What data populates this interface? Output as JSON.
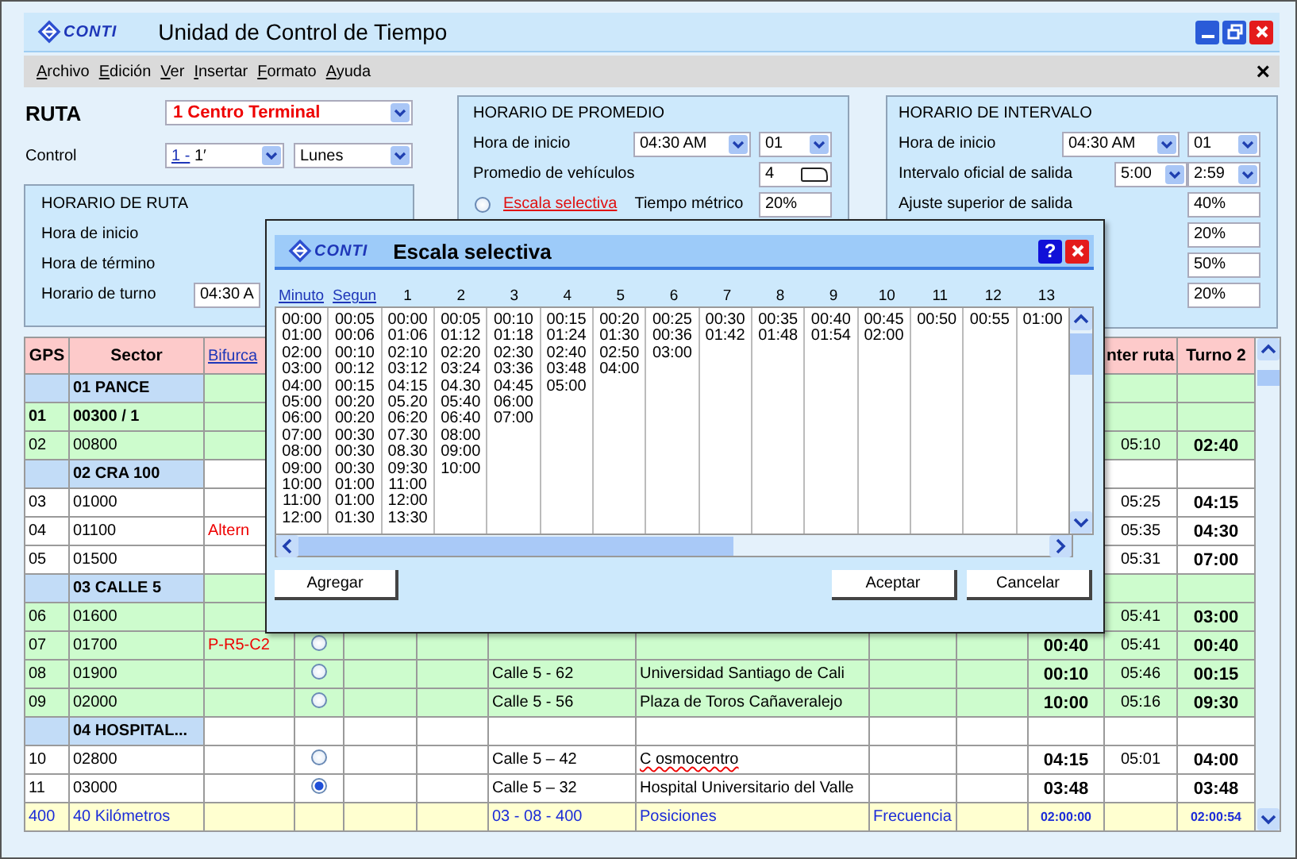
{
  "window": {
    "logo": "CONTI",
    "title": "Unidad de Control de Tiempo"
  },
  "menu": {
    "items": [
      "Archivo",
      "Edición",
      "Ver",
      "Insertar",
      "Formato",
      "Ayuda"
    ],
    "close": "×"
  },
  "route": {
    "label": "RUTA",
    "value": "1 Centro Terminal"
  },
  "control": {
    "label": "Control",
    "code": "1 -",
    "minute": "1′",
    "day": "Lunes"
  },
  "route_schedule": {
    "title": "HORARIO DE RUTA",
    "rows": [
      {
        "label": "Hora de inicio"
      },
      {
        "label": "Hora de término"
      },
      {
        "label": "Horario de turno",
        "value": "04:30 A"
      }
    ]
  },
  "average_schedule": {
    "title": "HORARIO DE PROMEDIO",
    "start_label": "Hora de inicio",
    "start_time": "04:30 AM",
    "start_index": "01",
    "vehicles_label": "Promedio de vehículos",
    "vehicles": "4",
    "option": {
      "label": "Escala selectiva",
      "selected": false
    },
    "metric_label": "Tiempo métrico",
    "metric": "20%"
  },
  "interval_schedule": {
    "title": "HORARIO DE INTERVALO",
    "start_label": "Hora de inicio",
    "start_time": "04:30 AM",
    "start_index": "01",
    "interval_label": "Intervalo oficial de salida",
    "interval": "5:00",
    "interval_2": "2:59",
    "adjust_label": "Ajuste superior de salida",
    "adjust": "40%",
    "more_values": [
      "20%",
      "50%",
      "20%"
    ]
  },
  "table": {
    "header": {
      "gps": "GPS",
      "sector": "Sector",
      "branch": "Bifurca",
      "column_12": "nter ruta",
      "turn_2": "Turno 2"
    },
    "rows": [
      {
        "kind": "group",
        "highlighted": true,
        "sector": "01 PANCE"
      },
      {
        "kind": "main",
        "highlighted": true,
        "gps": "01",
        "sector": "00300 / 1"
      },
      {
        "kind": "stop",
        "highlighted": true,
        "gps": "02",
        "sector": "00800",
        "column_12": "05:10",
        "turn_2": "02:40"
      },
      {
        "kind": "group",
        "highlighted": false,
        "sector": "02 CRA 100"
      },
      {
        "kind": "stop",
        "highlighted": false,
        "gps": "03",
        "sector": "01000",
        "column_12": "05:25",
        "turn_2": "04:15"
      },
      {
        "kind": "stop",
        "highlighted": false,
        "gps": "04",
        "sector": "01100",
        "branch": "Altern",
        "column_12": "05:35",
        "turn_2": "04:30"
      },
      {
        "kind": "stop",
        "highlighted": false,
        "gps": "05",
        "sector": "01500",
        "column_12": "05:31",
        "turn_2": "07:00"
      },
      {
        "kind": "group",
        "highlighted": true,
        "sector": "03 CALLE 5"
      },
      {
        "kind": "stop",
        "highlighted": true,
        "gps": "06",
        "sector": "01600",
        "column_12": "05:41",
        "turn_2": "03:00"
      },
      {
        "kind": "stop",
        "highlighted": true,
        "gps": "07",
        "sector": "01700",
        "branch": "P-R5-C2",
        "option": {
          "selected": false
        },
        "column_11": "00:40",
        "column_12": "05:41",
        "turn_2": "00:40"
      },
      {
        "kind": "stop",
        "highlighted": true,
        "flagged": false,
        "gps": "08",
        "sector": "01900",
        "option": {
          "selected": false
        },
        "column_7": "Calle 5 - 62",
        "column_8": "Universidad Santiago de Cali",
        "column_11": "00:10",
        "column_12": "05:46",
        "turn_2": "00:15"
      },
      {
        "kind": "stop",
        "highlighted": true,
        "flagged": false,
        "gps": "09",
        "sector": "02000",
        "option": {
          "selected": false
        },
        "column_7": "Calle 5 - 56",
        "column_8": "Plaza de Toros Cañaveralejo",
        "column_11": "10:00",
        "column_12": "05:16",
        "turn_2": "09:30"
      },
      {
        "kind": "group",
        "highlighted": false,
        "sector": "04 HOSPITAL..."
      },
      {
        "kind": "stop",
        "highlighted": false,
        "flagged": true,
        "gps": "10",
        "sector": "02800",
        "option": {
          "selected": false
        },
        "column_7": "Calle 5 – 42",
        "column_8": "C osmocentro",
        "column_11": "04:15",
        "column_12": "05:01",
        "turn_2": "04:00"
      },
      {
        "kind": "stop",
        "highlighted": false,
        "flagged": false,
        "gps": "11",
        "sector": "03000",
        "option": {
          "selected": true
        },
        "column_7": "Calle 5 – 32",
        "column_8": "Hospital Universitario del Valle",
        "column_11": "03:48",
        "turn_2": "03:48"
      }
    ],
    "footer": {
      "gps": "400",
      "sector": "40 Kilómetros",
      "column_7": "03 - 08 - 400",
      "column_8": "Posiciones",
      "column_9": "Frecuencia",
      "column_11": "02:00:00",
      "turn_2": "02:00:54"
    }
  },
  "dialog": {
    "logo": "CONTI",
    "title": "Escala selectiva",
    "help": "?",
    "columns": [
      {
        "label": "Minuto",
        "kind": "link",
        "values": [
          "00:00",
          "01:00",
          "02:00",
          "03:00",
          "04:00",
          "05:00",
          "06:00",
          "07:00",
          "08:00",
          "09:00",
          "10:00",
          "11:00",
          "12:00"
        ]
      },
      {
        "label": "Segun",
        "kind": "link",
        "values": [
          "00:05",
          "00:06",
          "00:10",
          "00:12",
          "00:15",
          "00:20",
          "00:20",
          "00:30",
          "00:30",
          "00:30",
          "01:00",
          "01:00",
          "01:30"
        ]
      },
      {
        "label": "1",
        "kind": "number",
        "values": [
          "00:00",
          "01:06",
          "02:10",
          "03:12",
          "04:15",
          "05.20",
          "06:20",
          "07.30",
          "08.30",
          "09:30",
          "11:00",
          "12:00",
          "13:30"
        ]
      },
      {
        "label": "2",
        "kind": "number",
        "values": [
          "00:05",
          "01:12",
          "02:20",
          "03:24",
          "04.30",
          "05:40",
          "06:40",
          "08:00",
          "09:00",
          "10:00"
        ]
      },
      {
        "label": "3",
        "kind": "number",
        "values": [
          "00:10",
          "01:18",
          "02:30",
          "03:36",
          "04:45",
          "06:00",
          "07:00"
        ]
      },
      {
        "label": "4",
        "kind": "number",
        "values": [
          "00:15",
          "01:24",
          "02:40",
          "03:48",
          "05:00"
        ]
      },
      {
        "label": "5",
        "kind": "number",
        "values": [
          "00:20",
          "01:30",
          "02:50",
          "04:00"
        ]
      },
      {
        "label": "6",
        "kind": "number",
        "values": [
          "00:25",
          "00:36",
          "03:00"
        ]
      },
      {
        "label": "7",
        "kind": "number",
        "values": [
          "00:30",
          "01:42"
        ]
      },
      {
        "label": "8",
        "kind": "number",
        "values": [
          "00:35",
          "01:48"
        ]
      },
      {
        "label": "9",
        "kind": "number",
        "values": [
          "00:40",
          "01:54"
        ]
      },
      {
        "label": "10",
        "kind": "number",
        "values": [
          "00:45",
          "02:00"
        ]
      },
      {
        "label": "11",
        "kind": "number",
        "values": [
          "00:50"
        ]
      },
      {
        "label": "12",
        "kind": "number",
        "values": [
          "00:55"
        ]
      },
      {
        "label": "13",
        "kind": "number",
        "values": [
          "01:00"
        ]
      }
    ],
    "buttons": [
      "Agregar",
      "Aceptar",
      "Cancelar"
    ]
  }
}
